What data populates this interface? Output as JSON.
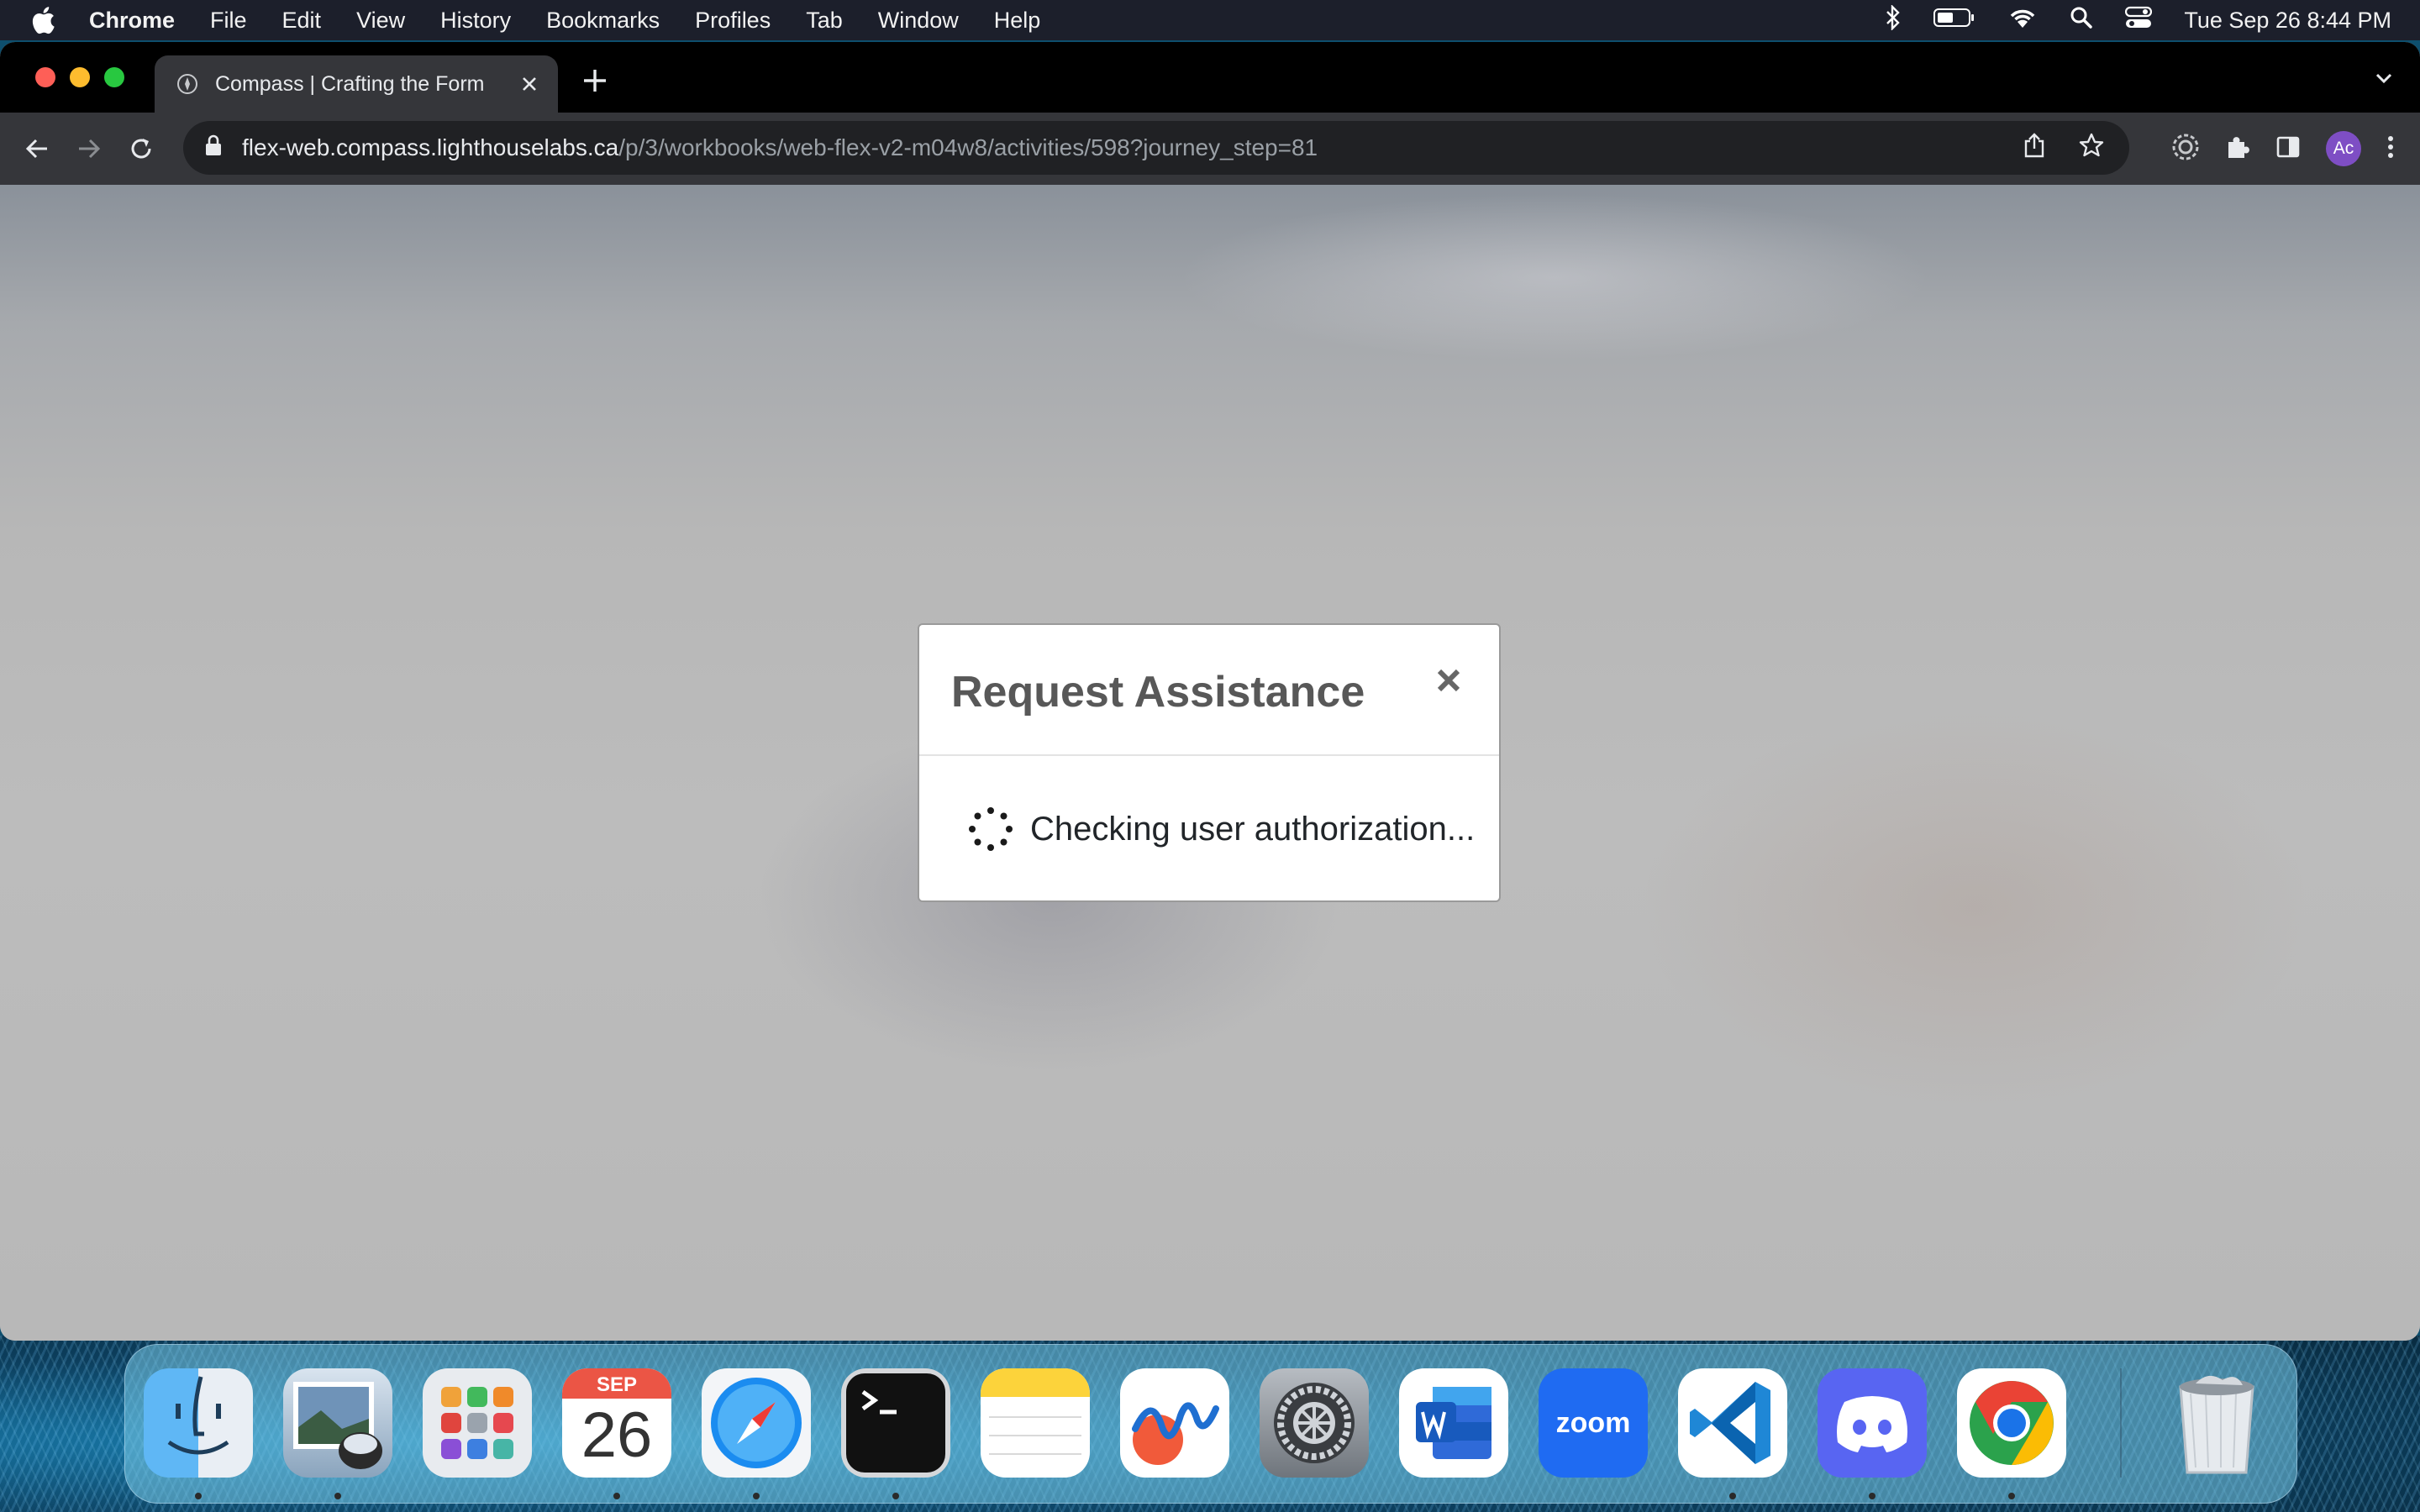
{
  "menubar": {
    "app_name": "Chrome",
    "items": [
      "File",
      "Edit",
      "View",
      "History",
      "Bookmarks",
      "Profiles",
      "Tab",
      "Window",
      "Help"
    ],
    "clock": "Tue Sep 26  8:44 PM",
    "status_icons": [
      "bluetooth-icon",
      "battery-icon",
      "wifi-icon",
      "spotlight-search-icon",
      "control-center-icon"
    ]
  },
  "browser": {
    "tab_title": "Compass | Crafting the Form",
    "url_host": "flex-web.compass.lighthouselabs.ca",
    "url_path": "/p/3/workbooks/web-flex-v2-m04w8/activities/598?journey_step=81",
    "avatar_initials": "Ac"
  },
  "modal": {
    "title": "Request Assistance",
    "status_text": "Checking user authorization..."
  },
  "dock": {
    "apps": [
      "Finder",
      "Preview",
      "Launchpad",
      "Calendar",
      "Safari",
      "Terminal",
      "Notes",
      "Freeform",
      "System Settings",
      "Microsoft Word",
      "Zoom",
      "Visual Studio Code",
      "Discord",
      "Google Chrome",
      "Trash"
    ],
    "calendar_month": "SEP",
    "calendar_day": "26",
    "zoom_label": "zoom"
  },
  "colors": {
    "menubar_bg": "#1c1f2b",
    "tab_bg": "#35363a",
    "modal_title": "#585858",
    "avatar": "#7e4ec4"
  }
}
